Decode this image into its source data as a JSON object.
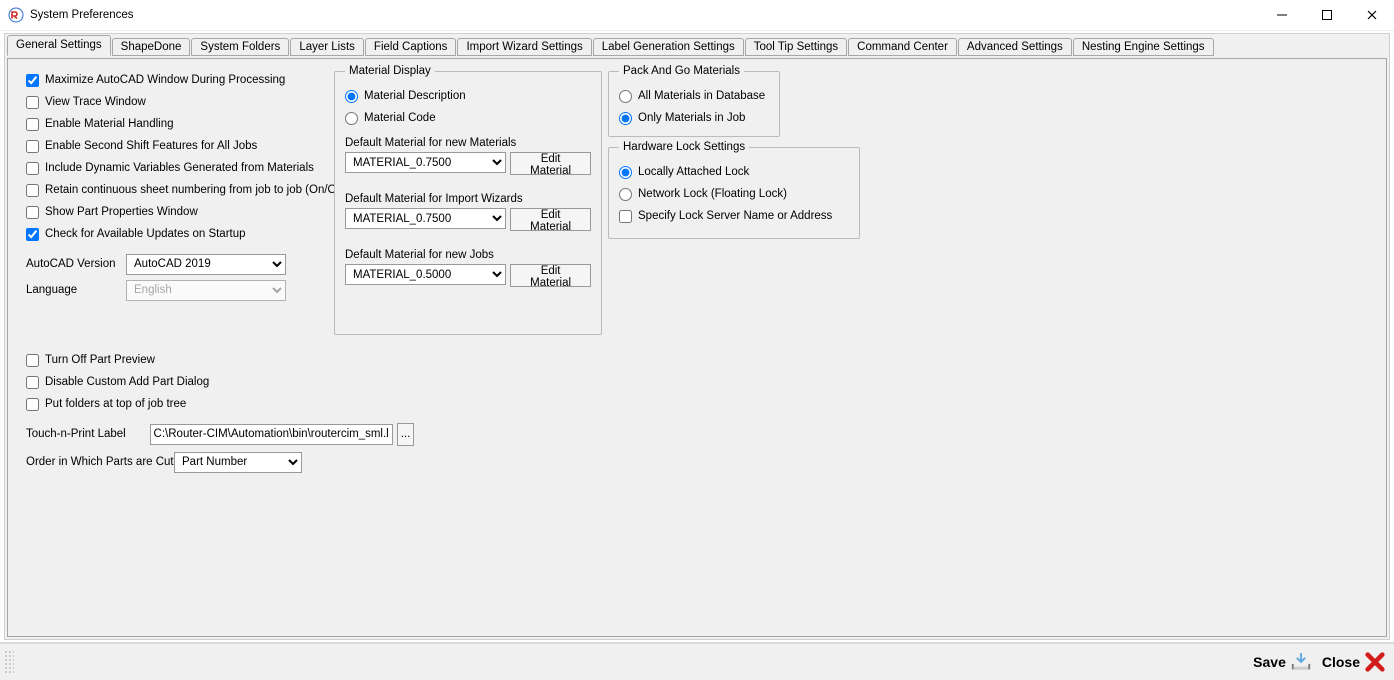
{
  "window": {
    "title": "System Preferences"
  },
  "tabs": [
    {
      "label": "General Settings"
    },
    {
      "label": "ShapeDone"
    },
    {
      "label": "System Folders"
    },
    {
      "label": "Layer Lists"
    },
    {
      "label": "Field Captions"
    },
    {
      "label": "Import Wizard Settings"
    },
    {
      "label": "Label Generation Settings"
    },
    {
      "label": "Tool Tip Settings"
    },
    {
      "label": "Command Center"
    },
    {
      "label": "Advanced Settings"
    },
    {
      "label": "Nesting Engine Settings"
    }
  ],
  "checkboxes": {
    "maximize_autocad": "Maximize AutoCAD Window During Processing",
    "view_trace": "View Trace Window",
    "enable_material_handling": "Enable Material Handling",
    "enable_second_shift": "Enable Second Shift Features for All Jobs",
    "include_dynamic_vars": "Include Dynamic Variables Generated from Materials",
    "retain_sheet_numbering": "Retain continuous sheet numbering from job to job (On/Off)",
    "show_part_properties": "Show Part Properties Window",
    "check_updates": "Check for Available Updates on Startup",
    "turn_off_preview": "Turn Off Part Preview",
    "disable_custom_add_part": "Disable Custom Add Part Dialog",
    "folders_at_top": "Put folders at top of job tree"
  },
  "acad_version": {
    "label": "AutoCAD Version",
    "value": "AutoCAD 2019"
  },
  "language": {
    "label": "Language",
    "value": "English"
  },
  "touch_n_print": {
    "label": "Touch-n-Print Label",
    "value": "C:\\Router-CIM\\Automation\\bin\\routercim_sml.lwl",
    "browse": "..."
  },
  "parts_cut_order": {
    "label": "Order in Which Parts are Cut",
    "value": "Part Number"
  },
  "material_display": {
    "legend": "Material Display",
    "radio_desc": "Material Description",
    "radio_code": "Material Code",
    "default_new_materials_label": "Default Material for new Materials",
    "default_new_materials_value": "MATERIAL_0.7500",
    "default_import_wizards_label": "Default Material for Import Wizards",
    "default_import_wizards_value": "MATERIAL_0.7500",
    "default_new_jobs_label": "Default Material for new Jobs",
    "default_new_jobs_value": "MATERIAL_0.5000",
    "edit_material": "Edit Material"
  },
  "pack_and_go": {
    "legend": "Pack And Go Materials",
    "all_db": "All Materials in Database",
    "only_job": "Only Materials in Job"
  },
  "hw_lock": {
    "legend": "Hardware Lock Settings",
    "local": "Locally Attached Lock",
    "network": "Network Lock (Floating Lock)",
    "specify": "Specify Lock Server Name or Address"
  },
  "footer": {
    "save": "Save",
    "close": "Close"
  }
}
